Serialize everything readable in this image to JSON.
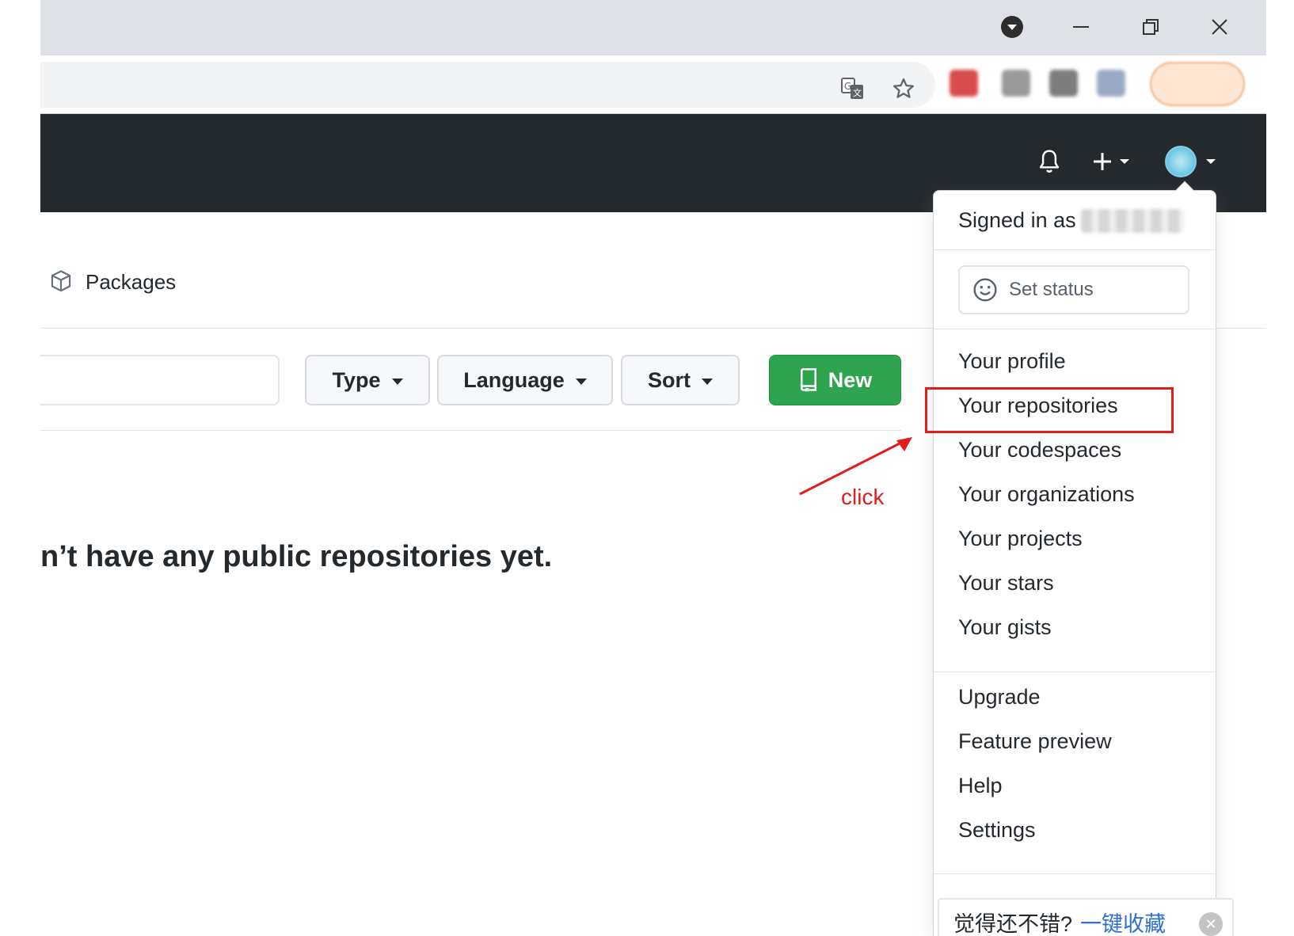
{
  "browser": {
    "window_controls": [
      "tab-search",
      "minimize",
      "restore",
      "close"
    ],
    "omnibox_icons": [
      "translate-icon",
      "bookmark-star-icon"
    ],
    "extension_colors": [
      "#d94c4c",
      "#9a9a9a",
      "#7d7d7d",
      "#9ca9c4"
    ]
  },
  "header": {
    "icons": [
      "bell-icon",
      "plus-icon",
      "avatar"
    ]
  },
  "nav": {
    "packages_label": "Packages"
  },
  "filters": {
    "type_label": "Type",
    "language_label": "Language",
    "sort_label": "Sort",
    "new_label": "New"
  },
  "empty_state": {
    "message": "n’t have any public repositories yet."
  },
  "annotation": {
    "label": "click",
    "color": "#e21c1c"
  },
  "dropdown": {
    "signed_in_prefix": "Signed in as",
    "set_status_label": "Set status",
    "items_group1": [
      "Your profile",
      "Your repositories",
      "Your codespaces",
      "Your organizations",
      "Your projects",
      "Your stars",
      "Your gists"
    ],
    "items_group2": [
      "Upgrade",
      "Feature preview",
      "Help",
      "Settings"
    ]
  },
  "banner": {
    "text": "觉得还不错?",
    "link": "一键收藏"
  },
  "colors": {
    "header_bg": "#24292e",
    "new_button": "#2ea44f",
    "highlight": "#e21c1c",
    "link": "#2f6fd1"
  }
}
